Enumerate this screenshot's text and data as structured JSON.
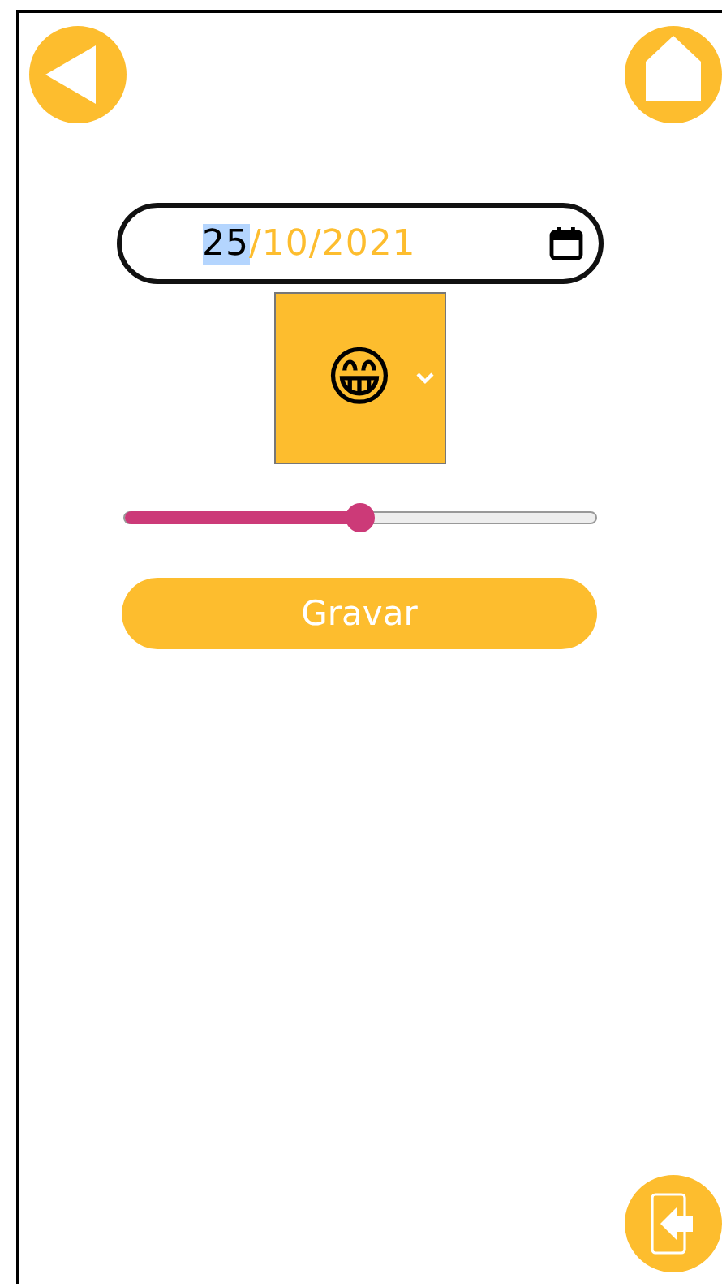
{
  "date_field": {
    "segments": [
      {
        "text": "25",
        "selected": true
      },
      {
        "text": "/10/2021",
        "selected": false
      }
    ]
  },
  "mood_select": {
    "value": "😁"
  },
  "slider": {
    "level": 0.5
  },
  "save_button": {
    "label": "Gravar"
  }
}
